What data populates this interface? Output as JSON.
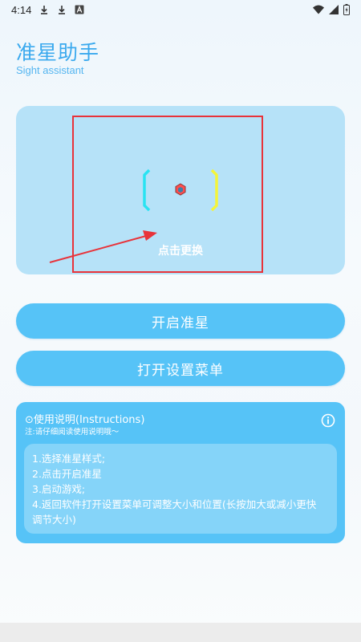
{
  "status_bar": {
    "time": "4:14",
    "icons": [
      "download-icon",
      "download-icon",
      "a-icon",
      "wifi-icon",
      "signal-icon",
      "battery-icon"
    ]
  },
  "header": {
    "title": "准星助手",
    "subtitle": "Sight assistant"
  },
  "preview": {
    "change_label": "点击更换"
  },
  "buttons": {
    "start": "开启准星",
    "settings": "打开设置菜单"
  },
  "instructions": {
    "title": "⊙使用说明(Instructions)",
    "note": "注:请仔细阅读使用说明哦～",
    "steps": [
      "1.选择准星样式;",
      "2.点击开启准星",
      "3.启动游戏;",
      "4.返回软件打开设置菜单可调整大小和位置(长按加大或减小更快",
      "调节大小)"
    ]
  },
  "colors": {
    "accent": "#56c3f7",
    "title": "#3aa9ee",
    "preview_bg": "#b6e2f8",
    "highlight": "#e8333a",
    "crosshair_left": "#29e3f2",
    "crosshair_right": "#f4f43a"
  }
}
